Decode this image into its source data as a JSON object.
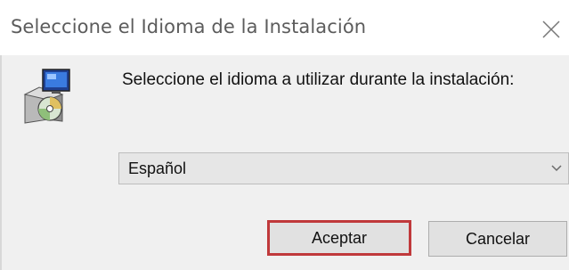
{
  "window": {
    "title": "Seleccione el Idioma de la Instalación",
    "close_icon": "close-icon"
  },
  "dialog": {
    "icon": "installer-setup-icon",
    "prompt": "Seleccione el idioma a utilizar durante la instalación:",
    "language_select": {
      "selected": "Español",
      "icon": "chevron-down-icon"
    },
    "buttons": {
      "accept_label": "Aceptar",
      "cancel_label": "Cancelar"
    },
    "colors": {
      "highlight_border": "#c0393b",
      "client_background": "#f0f0f0",
      "button_background": "#e1e1e1"
    }
  }
}
